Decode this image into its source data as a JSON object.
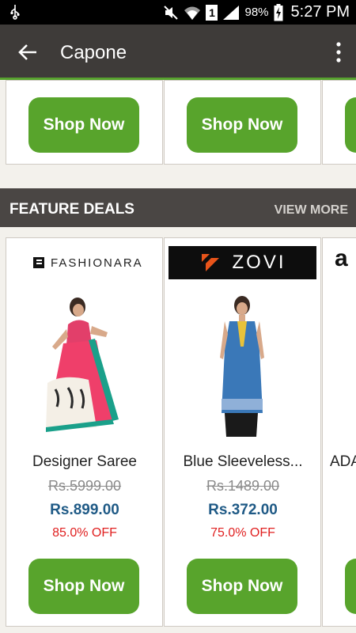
{
  "status_bar": {
    "battery_percent": "98%",
    "sim_slot": "1",
    "time": "5:27 PM",
    "icons": [
      "usb-icon",
      "mute-icon",
      "wifi-icon",
      "signal-icon",
      "battery-charging-icon"
    ]
  },
  "app_bar": {
    "title": "Capone",
    "icons": [
      "back-arrow-icon",
      "overflow-menu-icon"
    ]
  },
  "top_row": {
    "buttons": [
      "Shop Now",
      "Shop Now"
    ]
  },
  "feature_deals": {
    "title": "FEATURE DEALS",
    "view_more": "VIEW MORE",
    "products": [
      {
        "brand": "FASHIONARA",
        "name": "Designer Saree",
        "mrp": "Rs.5999.00",
        "price": "Rs.899.00",
        "discount": "85.0% OFF",
        "button": "Shop Now"
      },
      {
        "brand": "ZOVI",
        "name": "Blue Sleeveless...",
        "mrp": "Rs.1489.00",
        "price": "Rs.372.00",
        "discount": "75.0% OFF",
        "button": "Shop Now"
      },
      {
        "brand": "a",
        "name": "ADA"
      }
    ]
  },
  "colors": {
    "app_bar": "#3e3b39",
    "accent_green": "#58a42c",
    "price_blue": "#1f5a86",
    "discount_red": "#e02020",
    "background": "#f3f1ec"
  }
}
